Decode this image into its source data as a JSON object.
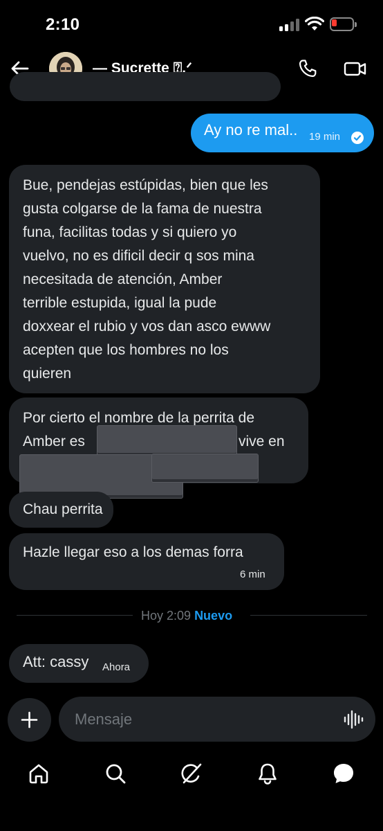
{
  "status_bar": {
    "time": "2:10",
    "battery_color": "#ff3b30"
  },
  "header": {
    "contact_name": "— Sucrette ⍰.ᐟ",
    "icons": [
      "back-arrow-icon",
      "phone-icon",
      "video-call-icon"
    ]
  },
  "messages": [
    {
      "direction": "outgoing",
      "text": "Ay no re mal..",
      "time": "19 min",
      "read": true
    },
    {
      "direction": "incoming",
      "lines": [
        "Bue, pendejas estúpidas, bien que les",
        "gusta colgarse de la fama de nuestra",
        "funa, facilitas todas y si quiero yo",
        "vuelvo, no es dificil decir q sos mina",
        "necesitada de atención, Amber",
        "terrible estupida, igual la pude",
        "doxxear el rubio y vos dan asco ewww",
        "acepten que los hombres no los",
        "quieren"
      ]
    },
    {
      "direction": "incoming",
      "line1": "Por cierto el nombre de la perrita de",
      "line2_start": "Amber es",
      "line2_end": "vive en",
      "redacted": true
    },
    {
      "direction": "incoming",
      "text": "Chau perrita"
    },
    {
      "direction": "incoming",
      "text": "Hazle llegar eso a los demas forra",
      "time": "6 min"
    },
    {
      "direction": "incoming",
      "text": "Att: cassy",
      "time": "Ahora"
    }
  ],
  "divider": {
    "time": "Hoy 2:09",
    "label": "Nuevo"
  },
  "composer": {
    "placeholder": "Mensaje",
    "add_icon": "plus-icon",
    "voice_icon": "voice-wave-icon"
  },
  "nav": [
    "home-icon",
    "search-icon",
    "grok-icon",
    "notifications-icon",
    "messages-icon"
  ],
  "colors": {
    "accent": "#1d9bf0",
    "bubble_incoming": "#202327",
    "background": "#000000"
  }
}
